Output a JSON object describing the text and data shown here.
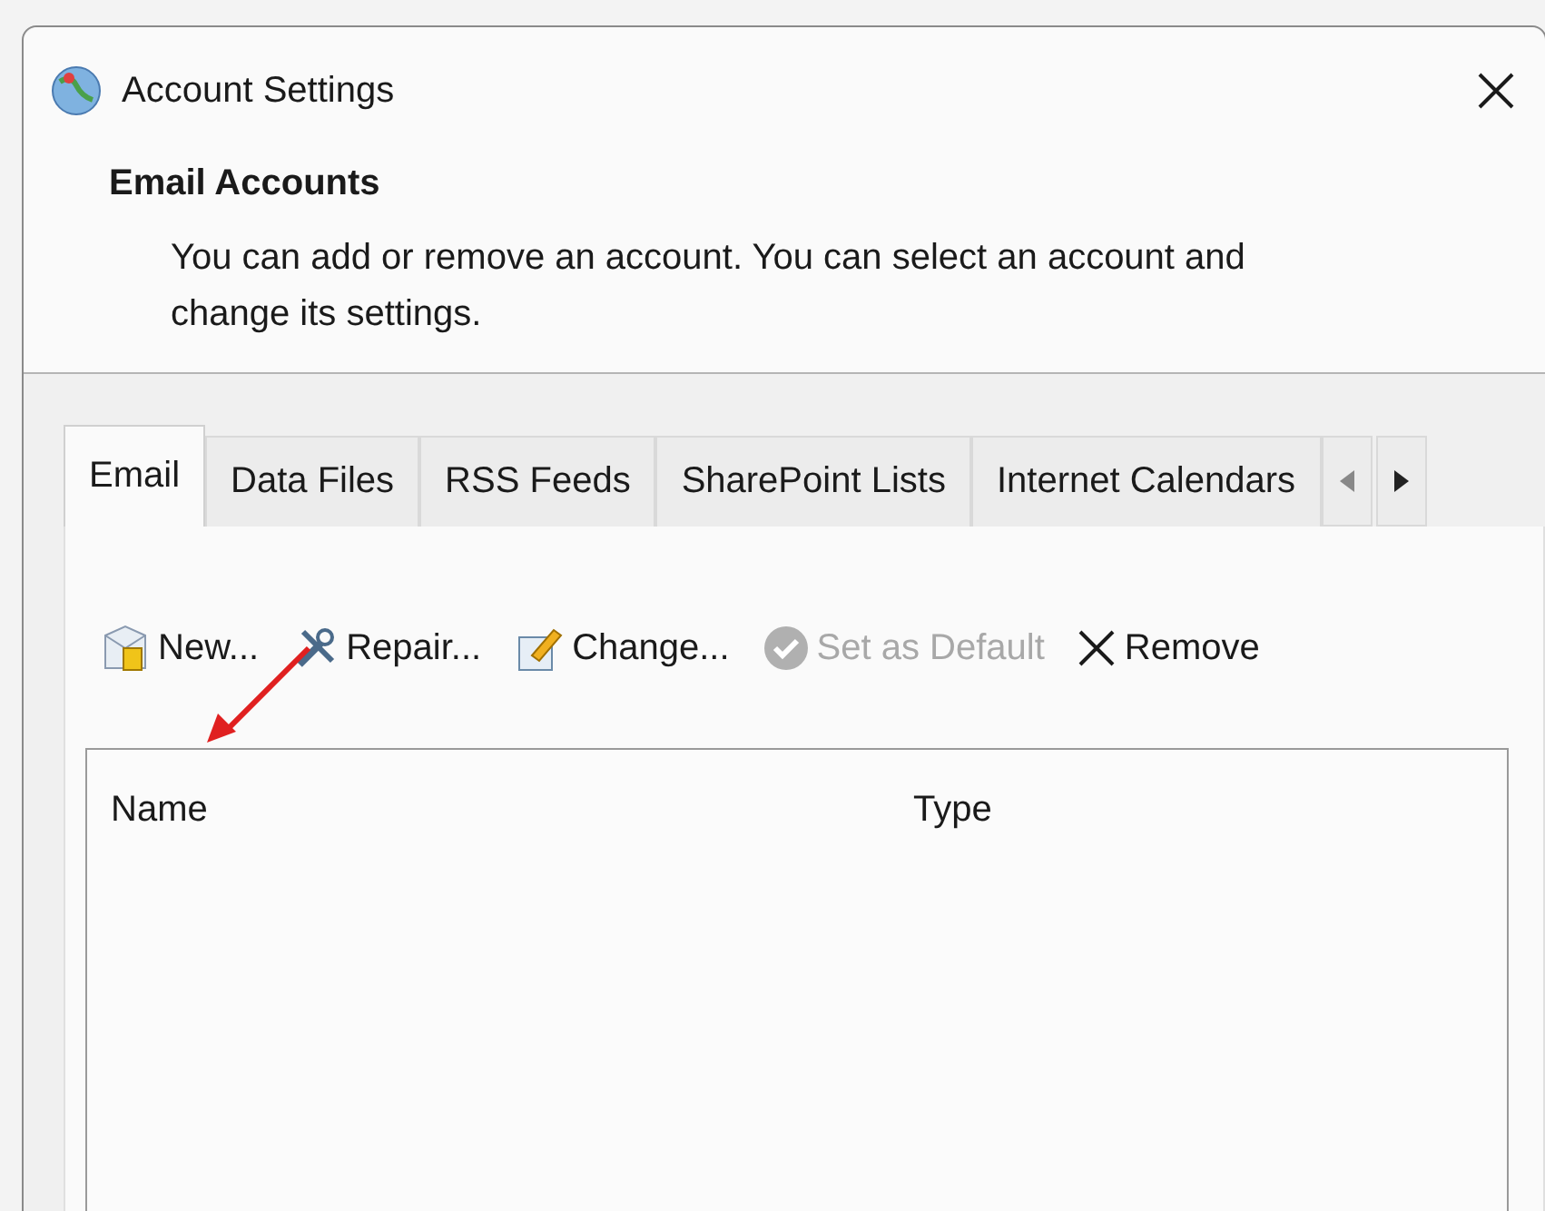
{
  "window": {
    "title": "Account Settings"
  },
  "header": {
    "title": "Email Accounts",
    "description": "You can add or remove an account. You can select an account and change its settings."
  },
  "tabs": [
    {
      "label": "Email",
      "selected": true
    },
    {
      "label": "Data Files",
      "selected": false
    },
    {
      "label": "RSS Feeds",
      "selected": false
    },
    {
      "label": "SharePoint Lists",
      "selected": false
    },
    {
      "label": "Internet Calendars",
      "selected": false
    }
  ],
  "toolbar": [
    {
      "kind": "new",
      "label": "New...",
      "disabled": false
    },
    {
      "kind": "repair",
      "label": "Repair...",
      "disabled": false
    },
    {
      "kind": "change",
      "label": "Change...",
      "disabled": false
    },
    {
      "kind": "default",
      "label": "Set as Default",
      "disabled": true
    },
    {
      "kind": "remove",
      "label": "Remove",
      "disabled": false
    }
  ],
  "table": {
    "columns": [
      "Name",
      "Type"
    ]
  }
}
